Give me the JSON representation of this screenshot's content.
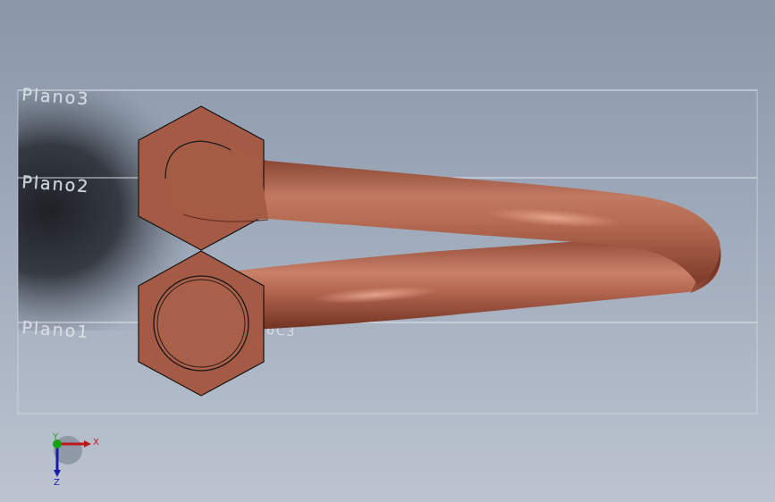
{
  "planes": [
    {
      "label": "Plano3"
    },
    {
      "label": "Plano2"
    },
    {
      "label": "Plano1"
    }
  ],
  "hidden_label_fragment": "oC3",
  "triad": {
    "x_label": "X",
    "y_label": "Y",
    "z_label": "Z"
  },
  "colors": {
    "pipe": "#a85a44",
    "pipe_highlight": "#d8937a",
    "pipe_shadow": "#6a3020",
    "fitting": "#a45a44",
    "axis_x": "#c01818",
    "axis_y": "#19a019",
    "axis_z": "#1a1ab0"
  }
}
